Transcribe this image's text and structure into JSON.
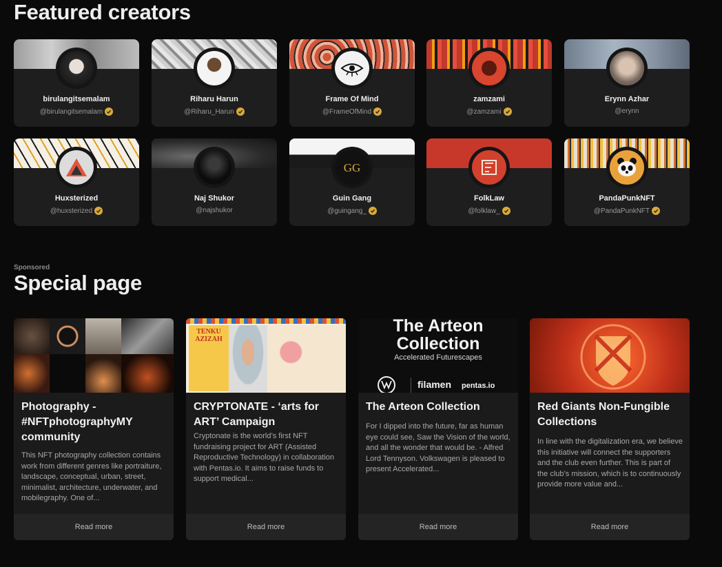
{
  "featured": {
    "title": "Featured creators",
    "creators": [
      {
        "name": "birulangitsemalam",
        "handle": "@birulangitsemalam",
        "verified": true,
        "icon": "portrait-avatar-icon"
      },
      {
        "name": "Riharu Harun",
        "handle": "@Riharu_Harun",
        "verified": true,
        "icon": "portrait-avatar-icon"
      },
      {
        "name": "Frame Of Mind",
        "handle": "@FrameOfMind",
        "verified": true,
        "icon": "eye-logo-icon"
      },
      {
        "name": "zamzami",
        "handle": "@zamzami",
        "verified": true,
        "icon": "illustrated-face-icon"
      },
      {
        "name": "Erynn Azhar",
        "handle": "@erynn",
        "verified": false,
        "icon": "portrait-avatar-icon"
      },
      {
        "name": "Huxsterized",
        "handle": "@huxsterized",
        "verified": true,
        "icon": "geometric-logo-icon"
      },
      {
        "name": "Naj Shukor",
        "handle": "@najshukor",
        "verified": false,
        "icon": "portrait-avatar-icon"
      },
      {
        "name": "Guin Gang",
        "handle": "@guingang_",
        "verified": true,
        "icon": "gg-logo-icon"
      },
      {
        "name": "FolkLaw",
        "handle": "@folklaw_",
        "verified": true,
        "icon": "folklaw-logo-icon"
      },
      {
        "name": "PandaPunkNFT",
        "handle": "@PandaPunkNFT",
        "verified": true,
        "icon": "panda-avatar-icon"
      }
    ]
  },
  "special": {
    "sponsored_label": "Sponsored",
    "title": "Special page",
    "cards": [
      {
        "title": "Photography - #NFTphotographyMY community",
        "description": "This NFT photography collection contains work from different genres like portraiture, landscape, conceptual, urban, street, minimalist, architecture, underwater, and mobilegraphy. One of...",
        "read_more": "Read more"
      },
      {
        "title": "CRYPTONATE - ‘arts for ART’ Campaign",
        "description": "Cryptonate is the world’s first NFT fundraising project for ART (Assisted Reproductive Technology) in collaboration with Pentas.io. It aims to raise funds to support medical...",
        "read_more": "Read more",
        "image_text": {
          "heading_line1": "TENKU",
          "heading_line2": "AZIZAH"
        }
      },
      {
        "title": "The Arteon Collection",
        "description": "For I dipped into the future, far as human eye could see, Saw the Vision of the world, and all the wonder that would be. - Alfred Lord Tennyson. Volkswagen is pleased to present Accelerated...",
        "read_more": "Read more",
        "image_text": {
          "heading_line1": "The Arteon",
          "heading_line2": "Collection",
          "subheading": "Accelerated Futurescapes",
          "brand_2": "filamen",
          "brand_3": "pentas.io"
        }
      },
      {
        "title": "Red Giants Non-Fungible Collections",
        "description": "In line with the digitalization era, we believe this initiative will connect the supporters and the club even further. This is part of the club’s mission, which is to continuously provide more value and...",
        "read_more": "Read more"
      }
    ]
  },
  "colors": {
    "background": "#0a0a0a",
    "card": "#1e1e1e",
    "verified_badge": "#d9a93a",
    "text_primary": "#f0f0f0",
    "text_muted": "#9a9a9a"
  }
}
